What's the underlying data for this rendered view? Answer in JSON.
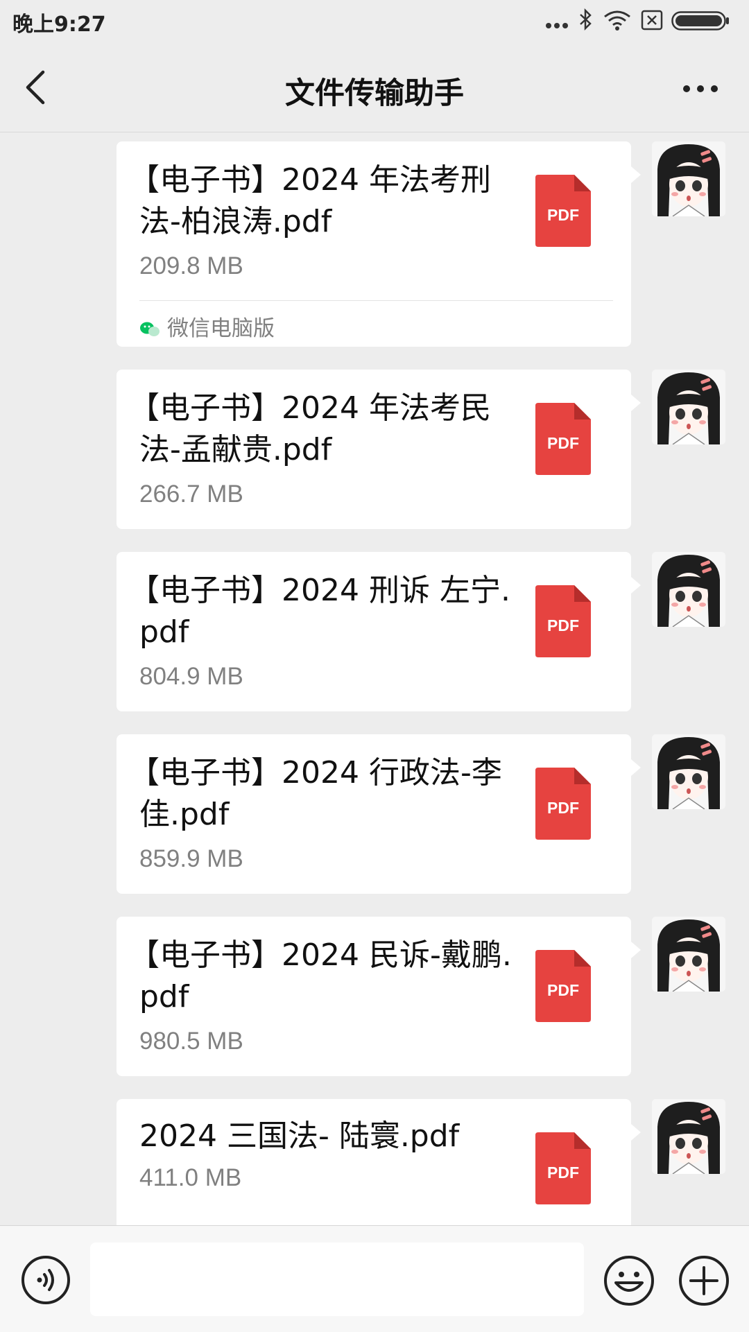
{
  "status": {
    "time": "晚上9:27"
  },
  "header": {
    "title": "文件传输助手"
  },
  "messages": [
    {
      "name_line1": "【电子书】2024 年法考刑",
      "name_line2": "法-柏浪涛.pdf",
      "size": "209.8 MB",
      "source": "微信电脑版",
      "icon_label": "PDF"
    },
    {
      "name_line1": "【电子书】2024 年法考民",
      "name_line2": "法-孟献贵.pdf",
      "size": "266.7 MB",
      "icon_label": "PDF"
    },
    {
      "name_line1": "【电子书】2024 刑诉  左宁.",
      "name_line2": "pdf",
      "size": "804.9 MB",
      "icon_label": "PDF"
    },
    {
      "name_line1": "【电子书】2024 行政法-李",
      "name_line2": "佳.pdf",
      "size": "859.9 MB",
      "icon_label": "PDF"
    },
    {
      "name_line1": "【电子书】2024 民诉-戴鹏.",
      "name_line2": "pdf",
      "size": "980.5 MB",
      "icon_label": "PDF"
    },
    {
      "name_line1": "2024 三国法- 陆寰.pdf",
      "name_line2": "",
      "size": "411.0 MB",
      "icon_label": "PDF"
    }
  ],
  "input": {
    "value": ""
  },
  "colors": {
    "pdf_red": "#e64340",
    "bubble": "#ffffff",
    "background": "#ededed",
    "wechat_green": "#07c160"
  }
}
